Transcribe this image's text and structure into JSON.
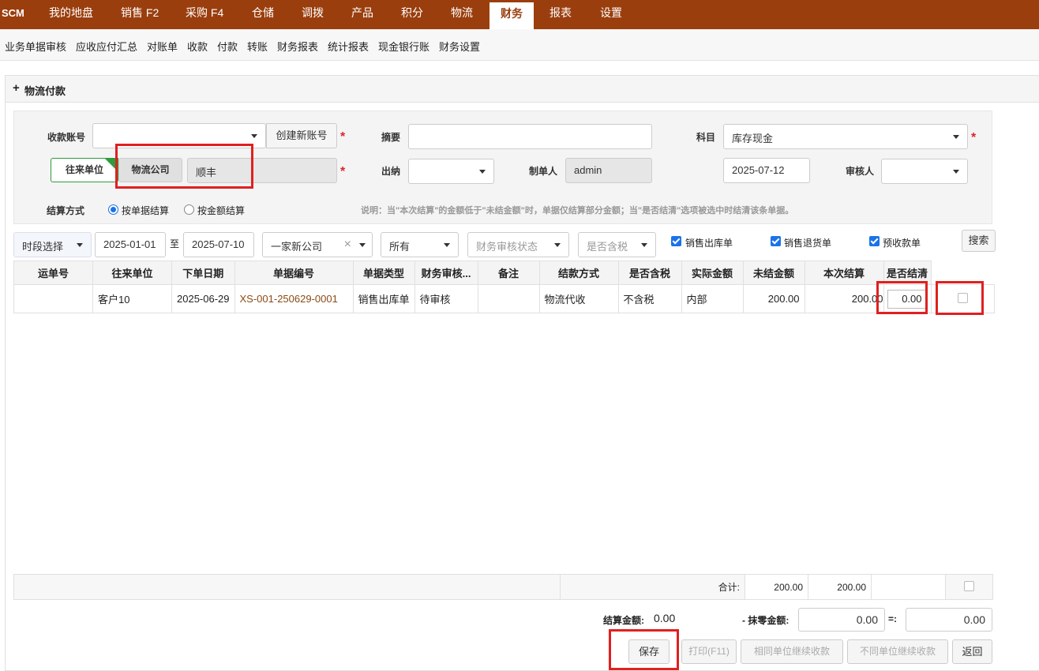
{
  "nav": {
    "brand": "SCM",
    "items": [
      "我的地盘",
      "销售 F2",
      "采购 F4",
      "仓储",
      "调拨",
      "产品",
      "积分",
      "物流",
      "财务",
      "报表",
      "设置"
    ],
    "active": "财务"
  },
  "subnav": [
    "业务单据审核",
    "应收应付汇总",
    "对账单",
    "收款",
    "付款",
    "转账",
    "财务报表",
    "统计报表",
    "现金银行账",
    "财务设置"
  ],
  "panel": {
    "title": "物流付款"
  },
  "form": {
    "account_label": "收款账号",
    "account_value": "",
    "create_account_btn": "创建新账号",
    "summary_label": "摘要",
    "summary_value": "",
    "subject_label": "科目",
    "subject_value": "库存现金",
    "party_btn": "往来单位",
    "logistics_btn": "物流公司",
    "party_value": "顺丰",
    "cashier_label": "出纳",
    "cashier_value": "",
    "maker_label": "制单人",
    "maker_value": "admin",
    "date_value": "2025-07-12",
    "auditor_label": "审核人",
    "auditor_value": "",
    "settle_mode_label": "结算方式",
    "settle_by_doc": "按单据结算",
    "settle_by_amount": "按金额结算",
    "note": "说明：当\"本次结算\"的金额低于\"未结金额\"时，单据仅结算部分金额；当\"是否结清\"选项被选中时结清该条单据。"
  },
  "filters": {
    "period_select": "时段选择",
    "date_from": "2025-01-01",
    "to_label": "至",
    "date_to": "2025-07-10",
    "company": "一家新公司",
    "all_select": "所有",
    "audit_status_placeholder": "财务审核状态",
    "tax_placeholder": "是否含税",
    "chk_sales_out": "销售出库单",
    "chk_sales_return": "销售退货单",
    "chk_prepay": "预收款单",
    "search_btn": "搜索"
  },
  "table": {
    "headers": [
      "运单号",
      "往来单位",
      "下单日期",
      "单据编号",
      "单据类型",
      "财务审核...",
      "备注",
      "结款方式",
      "是否含税",
      "实际金额",
      "未结金额",
      "本次结算",
      "是否结清"
    ],
    "rows": [
      {
        "waybill": "",
        "party": "客户10",
        "date": "2025-06-29",
        "doc_no": "XS-001-250629-0001",
        "doc_type": "销售出库单",
        "audit": "待审核",
        "remark": "",
        "pay_method": "物流代收",
        "tax": "不含税",
        "actual": "内部",
        "unsettled": "200.00",
        "this_settle": "200.00",
        "input_value": "0.00"
      }
    ]
  },
  "totals": {
    "label": "合计:",
    "unsettled": "200.00",
    "this_settle": "200.00"
  },
  "footer": {
    "settle_amount_label": "结算金额:",
    "settle_amount": "0.00",
    "round_label": "- 抹零金额:",
    "round_value": "0.00",
    "equals": "=:",
    "final_value": "0.00",
    "save_btn": "保存",
    "print_btn": "打印(F11)",
    "same_unit_btn": "相同单位继续收款",
    "diff_unit_btn": "不同单位继续收款",
    "back_btn": "返回"
  }
}
